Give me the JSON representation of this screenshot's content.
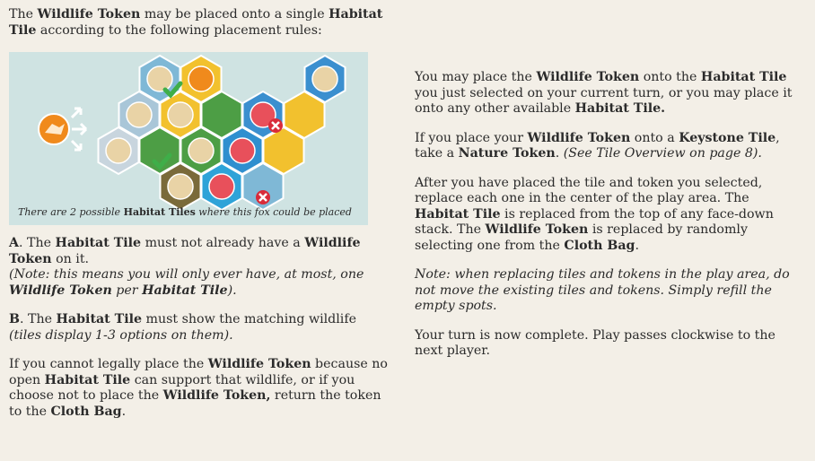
{
  "intro": {
    "t1": "The ",
    "wildlife_token": "Wildlife Token",
    "t2": " may be placed onto a single ",
    "habitat_tile": "Habitat Tile",
    "t3": " according to the following placement rules:"
  },
  "figure": {
    "caption_pre": "There are 2 possible ",
    "caption_bold": "Habitat Tiles",
    "caption_post": " where this fox could be placed"
  },
  "rule_a": {
    "letter": "A",
    "t1": ". The ",
    "habitat_tile": "Habitat Tile",
    "t2": " must not already have a ",
    "wildlife_token": "Wildlife Token",
    "t3": " on it.",
    "note1": "(Note: this means you will only ever have, at most, one ",
    "note_bold1": "Wildlife Token",
    "note2": " per ",
    "note_bold2": "Habitat Tile",
    "note3": ")."
  },
  "rule_b": {
    "letter": "B",
    "t1": ". The ",
    "habitat_tile": "Habitat Tile",
    "t2": " must show the matching wildlife ",
    "note": "(tiles display 1-3 options on them)."
  },
  "cannot_place": {
    "t1": "If you cannot legally place the ",
    "wildlife_token": "Wildlife Token",
    "t2": " because no open ",
    "habitat_tile": "Habitat Tile",
    "t3": " can support that wildlife, or if you choose not to place the ",
    "wildlife_token2": "Wildlife Token,",
    "t4": " return the token to the ",
    "cloth_bag": "Cloth Bag",
    "t5": "."
  },
  "right": {
    "p1_t1": "You may place the ",
    "p1_wt": "Wildlife Token",
    "p1_t2": " onto the ",
    "p1_ht": "Habitat Tile",
    "p1_t3": " you just selected on your current turn, or you may place it onto any other available ",
    "p1_ht2": "Habitat Tile.",
    "p2_t1": "If you place your ",
    "p2_wt": "Wildlife Token",
    "p2_t2": " onto a ",
    "p2_kt": "Keystone Tile",
    "p2_t3": ", take a ",
    "p2_nt": "Nature Token",
    "p2_t4": ". ",
    "p2_note": "(See Tile Overview on page 8).",
    "p3_t1": "After you have placed the tile and token you selected, replace each one in the center of the play area. The ",
    "p3_ht": "Habitat Tile",
    "p3_t2": " is replaced from the top of any face-down stack. The ",
    "p3_wt": "Wildlife Token",
    "p3_t3": " is replaced by randomly selecting one from the ",
    "p3_cb": "Cloth Bag",
    "p3_t4": ".",
    "p4": "Note: when replacing tiles and tokens in the play area, do not move the existing tiles and tokens. Simply refill the empty spots.",
    "p5": "Your turn is now complete. Play passes clockwise to the next player."
  },
  "colors": {
    "background": "#f3efe7",
    "panel": "#cfe3e2",
    "fox_token": "#f08a1c",
    "check": "#3fae49",
    "cross": "#d92b3a",
    "salmon_token": "#e8505b",
    "wildlife_token_face": "#e9d3a6"
  },
  "icons": [
    "fox-token-icon",
    "arrow-icon",
    "check-icon",
    "cross-icon",
    "elk-icon",
    "bear-icon",
    "salmon-icon",
    "hawk-icon"
  ]
}
